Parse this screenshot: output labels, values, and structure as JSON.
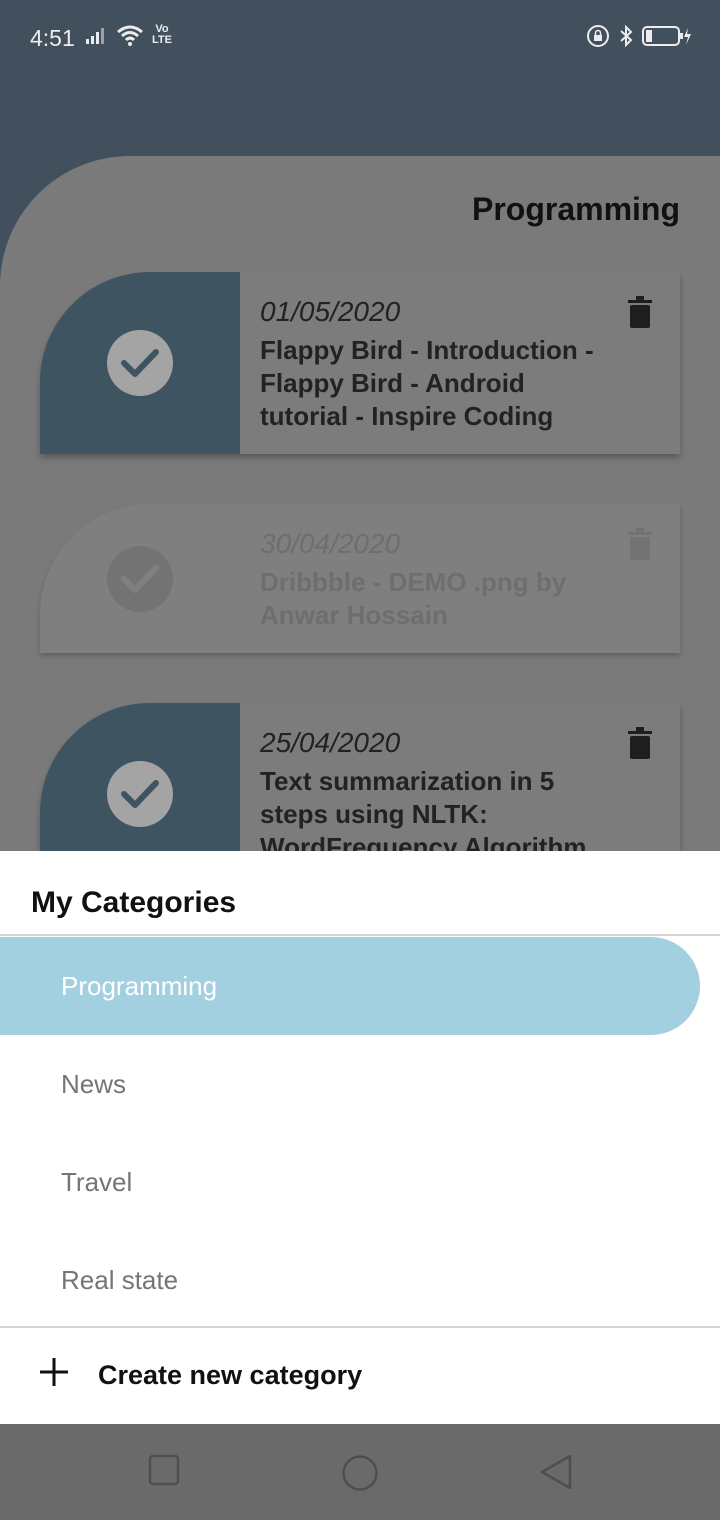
{
  "status_bar": {
    "time": "4:51",
    "volte_top": "Vo",
    "volte_bottom": "LTE"
  },
  "header": {
    "title": "Programming"
  },
  "cards": [
    {
      "date": "01/05/2020",
      "title": "Flappy Bird - Introduction - Flappy Bird - Android tutorial - Inspire Coding",
      "checked": true
    },
    {
      "date": "30/04/2020",
      "title": "Dribbble - DEMO .png by Anwar Hossain",
      "checked": false
    },
    {
      "date": "25/04/2020",
      "title": "Text summarization in 5 steps using NLTK: WordFrequency Algorithm",
      "checked": true
    }
  ],
  "sheet": {
    "title": "My Categories",
    "categories": [
      "Programming",
      "News",
      "Travel",
      "Real state"
    ],
    "selected_category": "Programming",
    "create_label": "Create new category"
  },
  "icons": {
    "check": "check-icon",
    "trash": "trash-icon",
    "plus": "plus-icon",
    "nav_recent": "square-icon",
    "nav_home": "circle-icon",
    "nav_back": "triangle-back-icon"
  },
  "colors": {
    "selected_bg": "#a3d0e1",
    "header_bg": "#42505e",
    "card_accent": "#3f5461"
  }
}
